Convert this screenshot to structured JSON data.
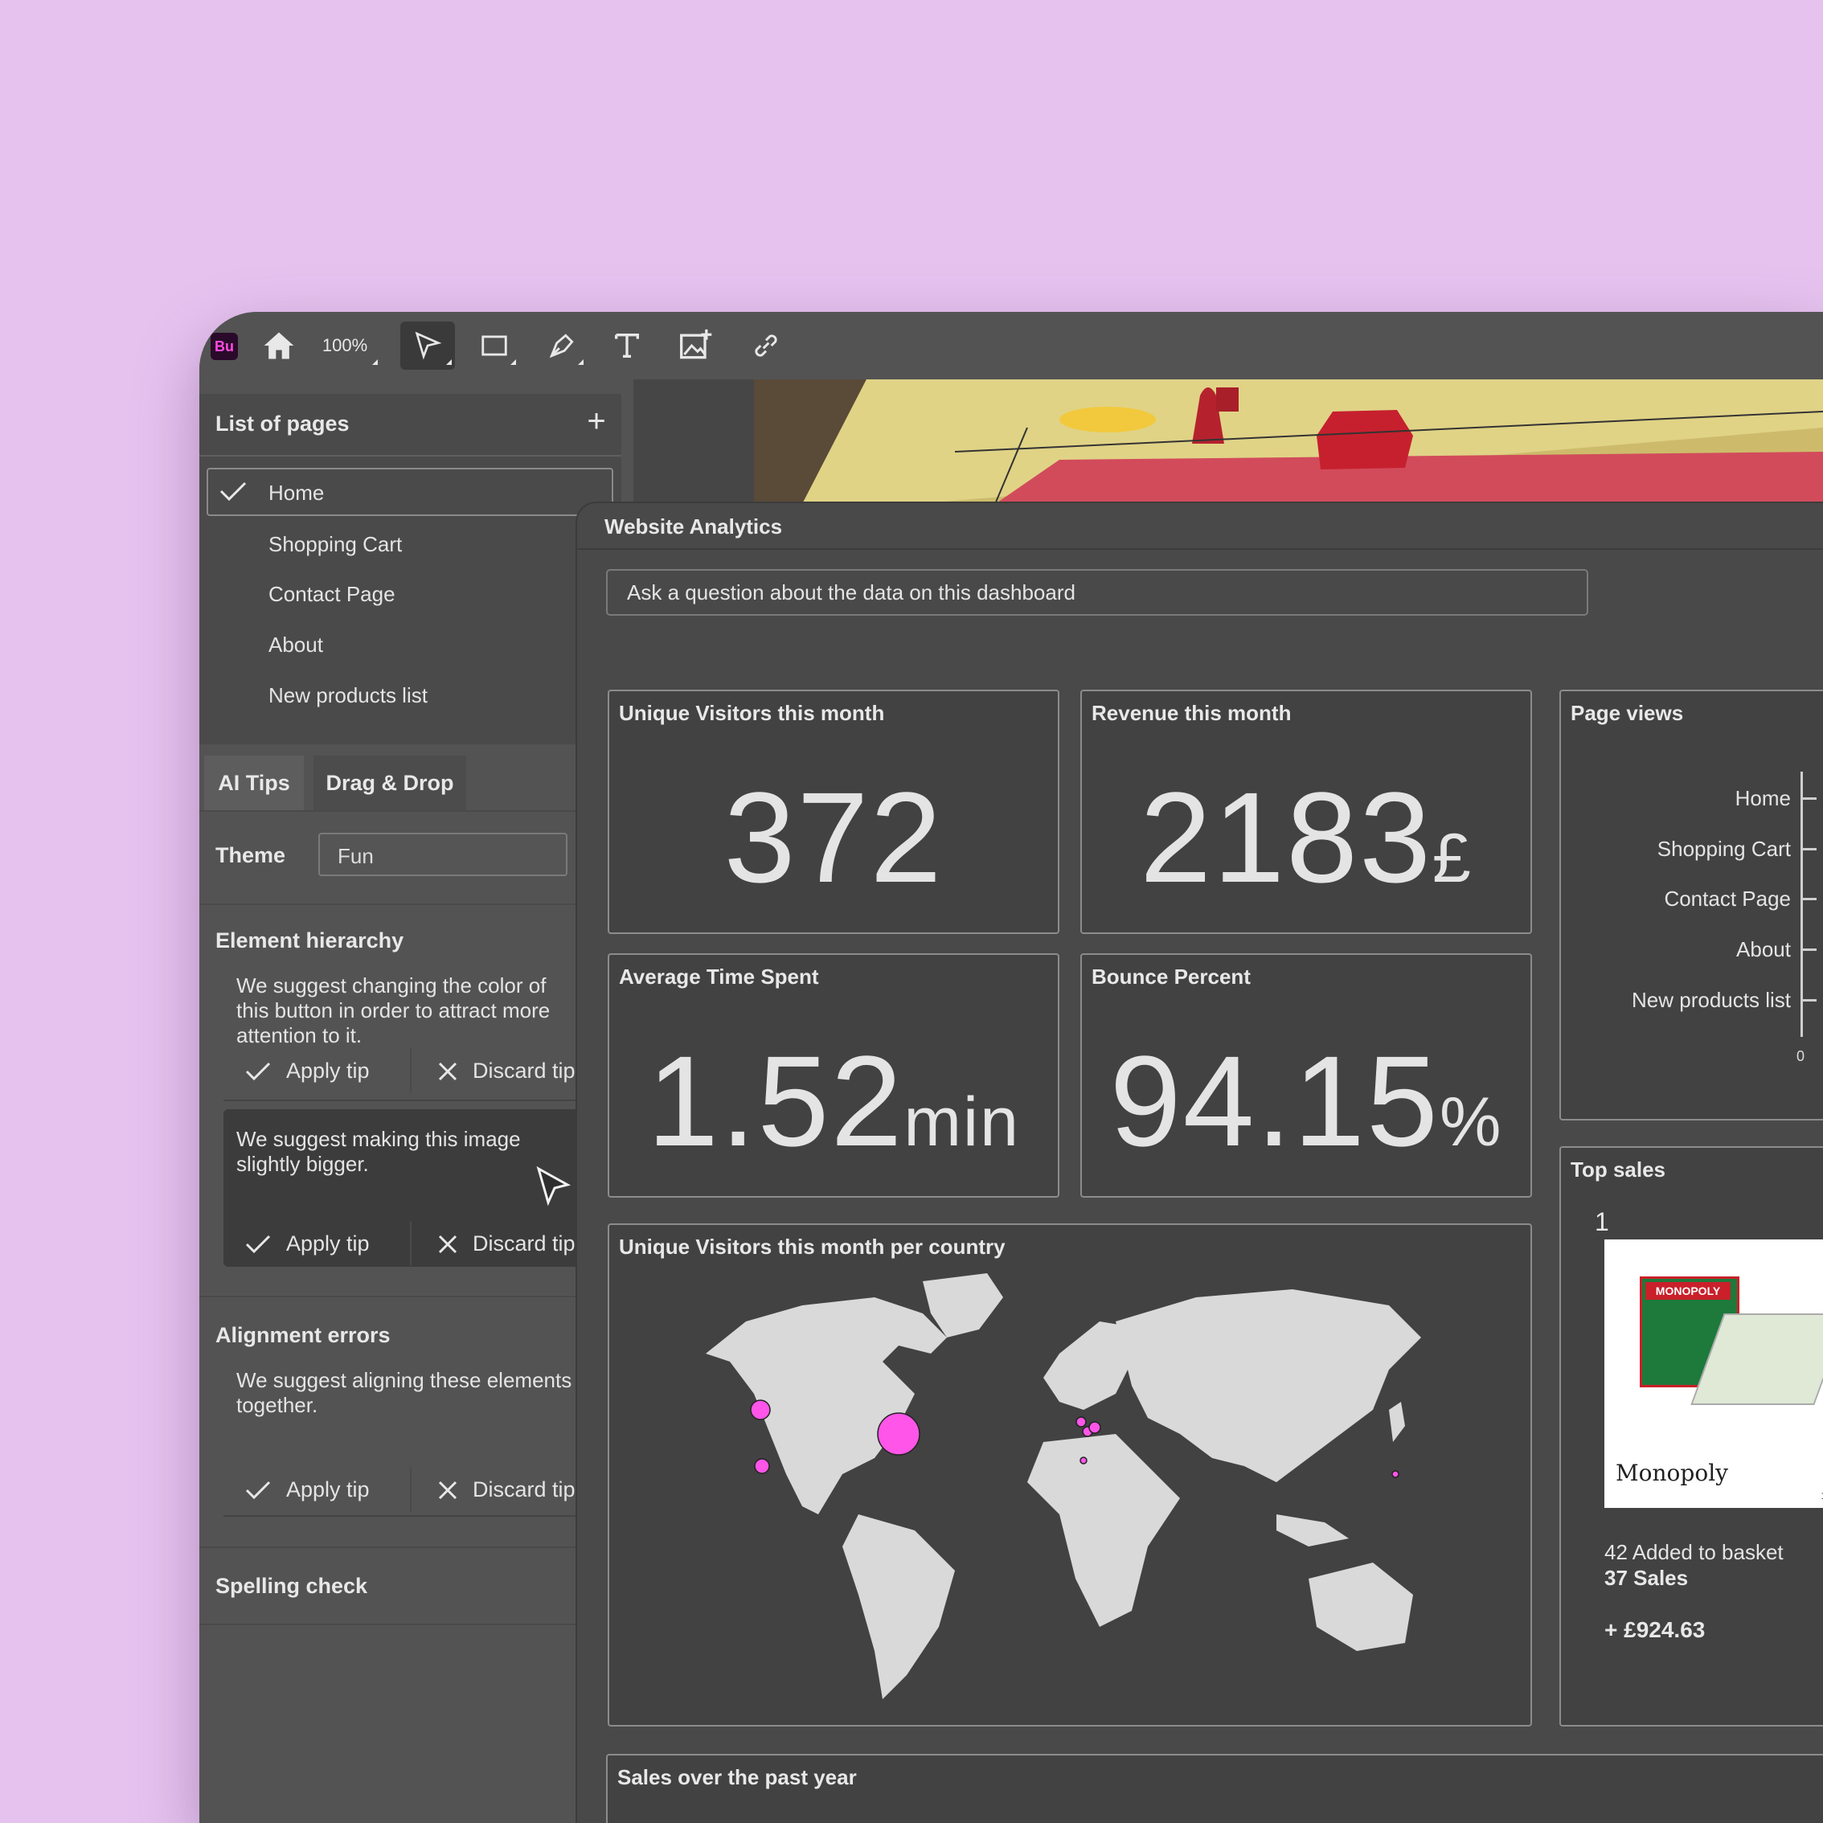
{
  "toolbar": {
    "app_badge": "Bu",
    "zoom": "100%",
    "icons": [
      "home-icon",
      "select-arrow-icon",
      "rectangle-icon",
      "pen-icon",
      "text-icon",
      "add-image-icon",
      "link-icon"
    ]
  },
  "pages_panel": {
    "title": "List of pages",
    "add_label": "+",
    "items": [
      {
        "label": "Home",
        "selected": true
      },
      {
        "label": "Shopping Cart"
      },
      {
        "label": "Contact Page"
      },
      {
        "label": "About"
      },
      {
        "label": "New products list"
      }
    ]
  },
  "tips_panel": {
    "tabs": [
      "AI Tips",
      "Drag & Drop"
    ],
    "theme_label": "Theme",
    "theme_value": "Fun",
    "sections": {
      "element_hierarchy": "Element hierarchy",
      "alignment_errors": "Alignment errors",
      "spelling_check": "Spelling check"
    },
    "tips": [
      {
        "text": "We suggest changing the color of this button in order to attract more attention to it.",
        "apply": "Apply tip",
        "discard": "Discard tip"
      },
      {
        "text": "We suggest making this image slightly bigger.",
        "apply": "Apply tip",
        "discard": "Discard tip"
      },
      {
        "text": "We suggest aligning these elements together.",
        "apply": "Apply tip",
        "discard": "Discard tip"
      }
    ]
  },
  "analytics": {
    "title": "Website Analytics",
    "ask_placeholder": "Ask a question about the data on this dashboard",
    "kpis": {
      "visitors": {
        "title": "Unique Visitors this month",
        "value": "372",
        "unit": ""
      },
      "revenue": {
        "title": "Revenue this month",
        "value": "2183",
        "unit": "£"
      },
      "time": {
        "title": "Average Time Spent",
        "value": "1.52",
        "unit": "min"
      },
      "bounce": {
        "title": "Bounce Percent",
        "value": "94.15",
        "unit": "%"
      }
    },
    "map": {
      "title": "Unique Visitors this month per country"
    },
    "page_views": {
      "title": "Page views",
      "labels": [
        "Home",
        "Shopping Cart",
        "Contact Page",
        "About",
        "New products list"
      ],
      "axis_zero": "0"
    },
    "top_sales": {
      "title": "Top sales",
      "rank": "1",
      "product": "Monopoly",
      "box_text": "MONOPOLY",
      "price_fragment": "£",
      "added": "42 Added to basket",
      "sales": "37 Sales",
      "revenue": "+ £924.63"
    },
    "sales_chart": {
      "title": "Sales over the past year"
    }
  },
  "colors": {
    "background": "#e6c3ef",
    "panel": "#535353",
    "bubble": "#ff55e8"
  }
}
